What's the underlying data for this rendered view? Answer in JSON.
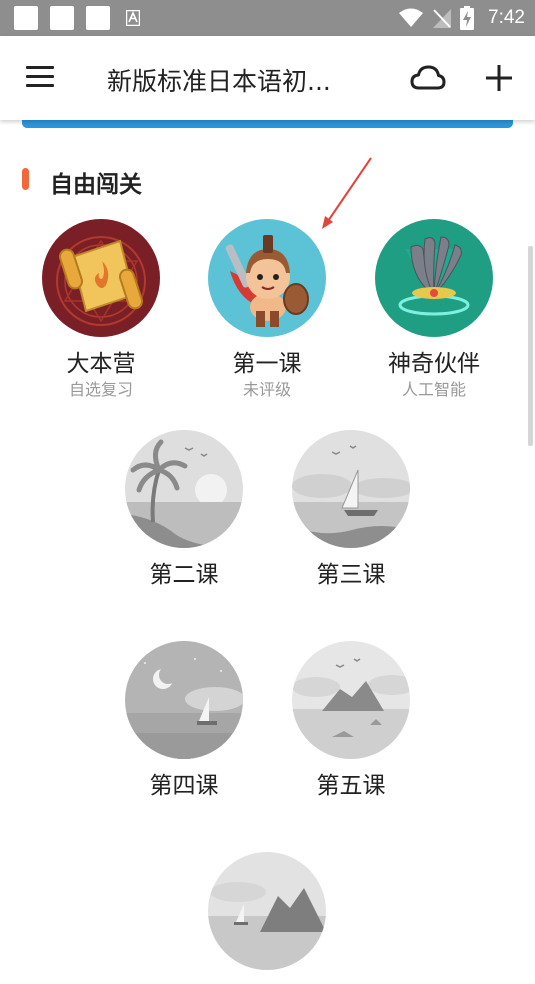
{
  "status_bar": {
    "time": "7:42",
    "icons": [
      "notification-square-icon",
      "notification-square-icon",
      "notification-square-icon",
      "text-a-icon",
      "wifi-icon",
      "no-signal-icon",
      "battery-charging-icon"
    ]
  },
  "app_bar": {
    "title": "新版标准日本语初...",
    "menu_icon": "menu-icon",
    "cloud_icon": "cloud-icon",
    "plus_icon": "plus-icon"
  },
  "section": {
    "title": "自由闯关",
    "accent_color": "#f2683b"
  },
  "lessons": [
    {
      "name": "大本营",
      "subtitle": "自选复习",
      "icon": "scroll-icon"
    },
    {
      "name": "第一课",
      "subtitle": "未评级",
      "icon": "warrior-icon"
    },
    {
      "name": "神奇伙伴",
      "subtitle": "人工智能",
      "icon": "feather-headdress-icon"
    },
    {
      "name": "第二课",
      "subtitle": "",
      "icon": "palm-beach-icon"
    },
    {
      "name": "第三课",
      "subtitle": "",
      "icon": "sailboat-icon"
    },
    {
      "name": "第四课",
      "subtitle": "",
      "icon": "moon-night-icon"
    },
    {
      "name": "第五课",
      "subtitle": "",
      "icon": "island-icon"
    },
    {
      "name": "",
      "subtitle": "",
      "icon": "mountain-boat-icon"
    }
  ],
  "colors": {
    "status_bar": "#8e8e8e",
    "banner": "#2b96dc",
    "arrow": "#e0463c"
  }
}
